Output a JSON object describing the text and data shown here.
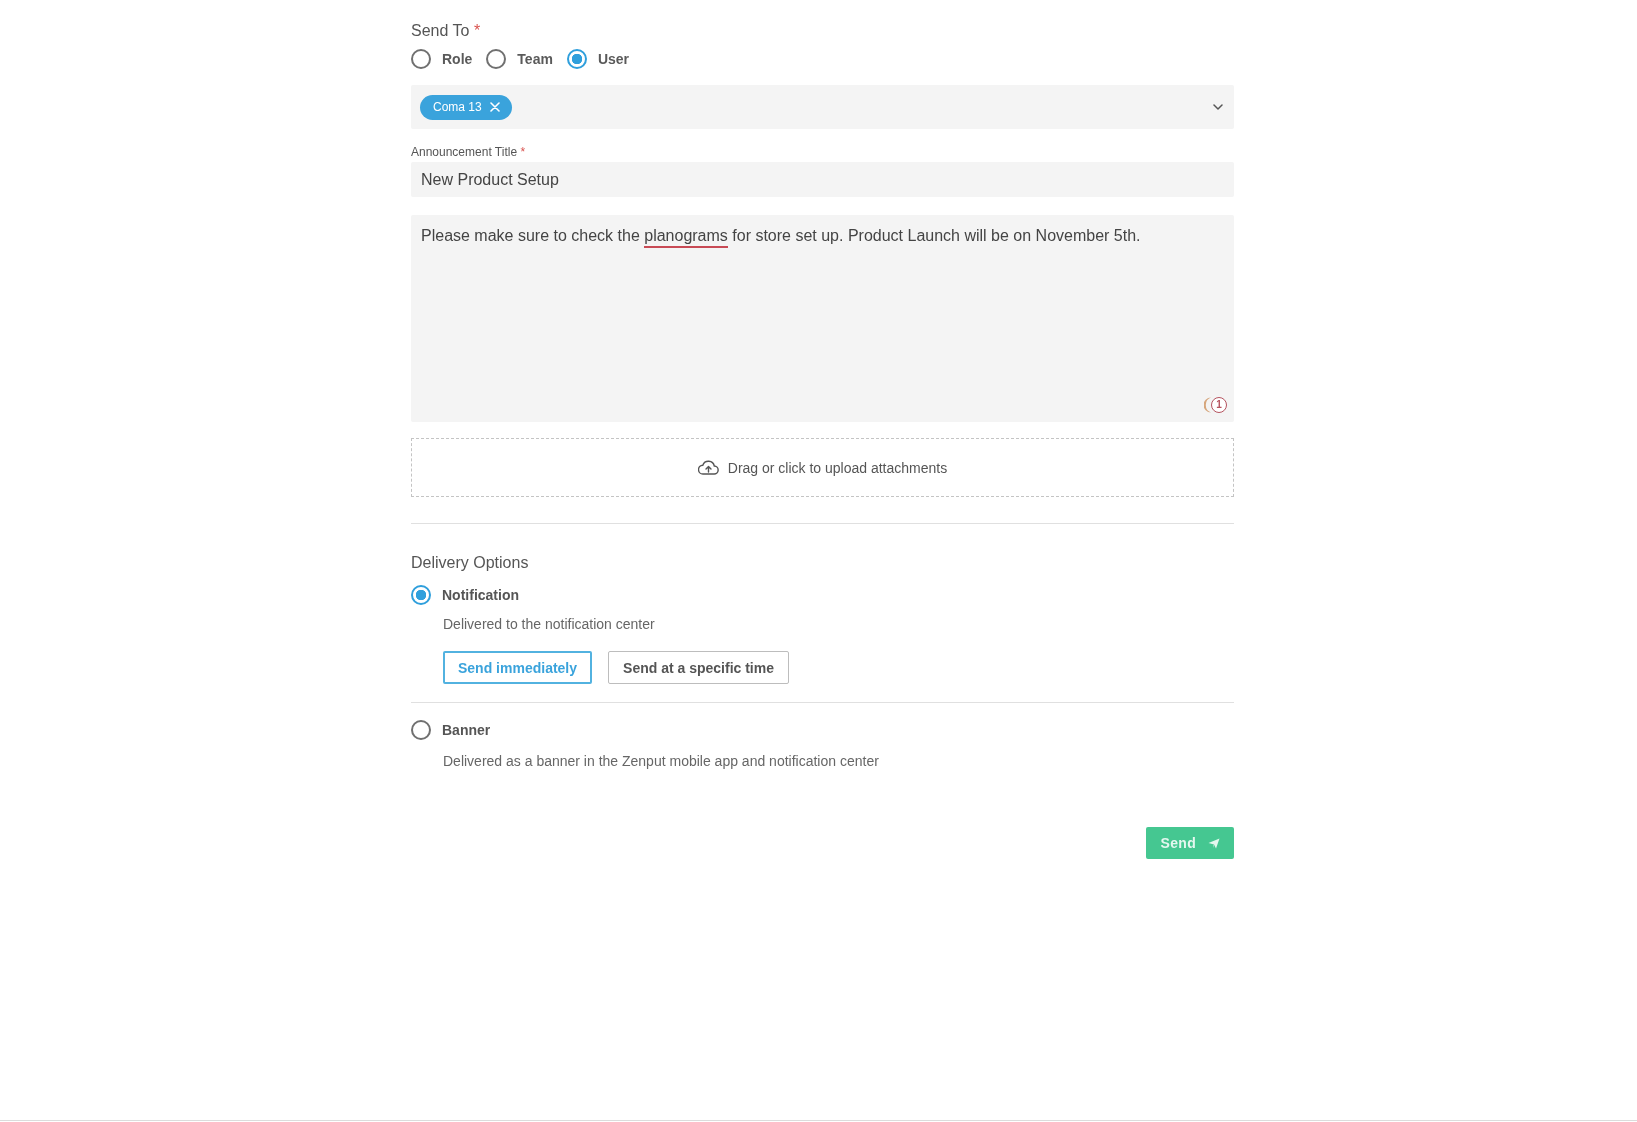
{
  "send_to": {
    "label": "Send To",
    "required_mark": "*",
    "options": [
      {
        "label": "Role",
        "selected": false
      },
      {
        "label": "Team",
        "selected": false
      },
      {
        "label": "User",
        "selected": true
      }
    ]
  },
  "recipients": {
    "chips": [
      {
        "label": "Coma 13"
      }
    ]
  },
  "title_field": {
    "label": "Announcement Title",
    "required_mark": "*",
    "value": "New Product Setup"
  },
  "message": {
    "segments": [
      {
        "text": "Please make sure to check the ",
        "flagged": false
      },
      {
        "text": "planograms",
        "flagged": true
      },
      {
        "text": " for store set up. Product Launch will be on November 5th.",
        "flagged": false
      }
    ],
    "badge_count": "1"
  },
  "upload": {
    "label": "Drag or click to upload attachments"
  },
  "delivery": {
    "title": "Delivery Options",
    "options": [
      {
        "label": "Notification",
        "selected": true,
        "description": "Delivered to the notification center",
        "timing": [
          {
            "label": "Send immediately",
            "selected": true
          },
          {
            "label": "Send at a specific time",
            "selected": false
          }
        ]
      },
      {
        "label": "Banner",
        "selected": false,
        "description": "Delivered as a banner in the Zenput mobile app and notification center"
      }
    ]
  },
  "send_button": {
    "label": "Send"
  }
}
